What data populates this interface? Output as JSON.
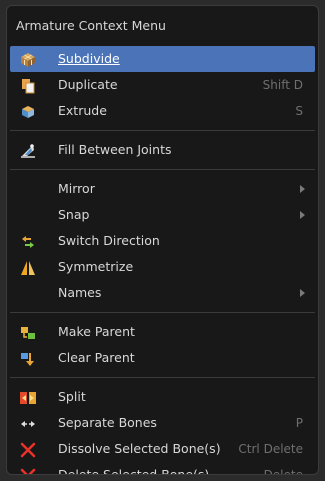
{
  "menu": {
    "title": "Armature Context Menu",
    "items": [
      {
        "label": "Subdivide",
        "shortcut": "",
        "icon": "subdivide-icon"
      },
      {
        "label": "Duplicate",
        "shortcut": "Shift D",
        "icon": "duplicate-icon"
      },
      {
        "label": "Extrude",
        "shortcut": "S",
        "icon": "extrude-icon"
      },
      {
        "label": "Fill Between Joints",
        "shortcut": "",
        "icon": "fill-between-joints-icon"
      },
      {
        "label": "Mirror",
        "shortcut": "",
        "icon": "",
        "submenu": true
      },
      {
        "label": "Snap",
        "shortcut": "",
        "icon": "",
        "submenu": true
      },
      {
        "label": "Switch Direction",
        "shortcut": "",
        "icon": "switch-direction-icon"
      },
      {
        "label": "Symmetrize",
        "shortcut": "",
        "icon": "symmetrize-icon"
      },
      {
        "label": "Names",
        "shortcut": "",
        "icon": "",
        "submenu": true
      },
      {
        "label": "Make Parent",
        "shortcut": "",
        "icon": "make-parent-icon"
      },
      {
        "label": "Clear Parent",
        "shortcut": "",
        "icon": "clear-parent-icon"
      },
      {
        "label": "Split",
        "shortcut": "",
        "icon": "split-icon"
      },
      {
        "label": "Separate Bones",
        "shortcut": "P",
        "icon": "separate-bones-icon"
      },
      {
        "label": "Dissolve Selected Bone(s)",
        "shortcut": "Ctrl Delete",
        "icon": "dissolve-x-icon"
      },
      {
        "label": "Delete Selected Bone(s)",
        "shortcut": "Delete",
        "icon": "delete-x-icon"
      }
    ]
  },
  "colors": {
    "menu_bg": "#181818",
    "highlight": "#4a73b8",
    "text": "#d8d8d8",
    "shortcut": "#6f6f6f",
    "delete_red": "#e8332a"
  }
}
